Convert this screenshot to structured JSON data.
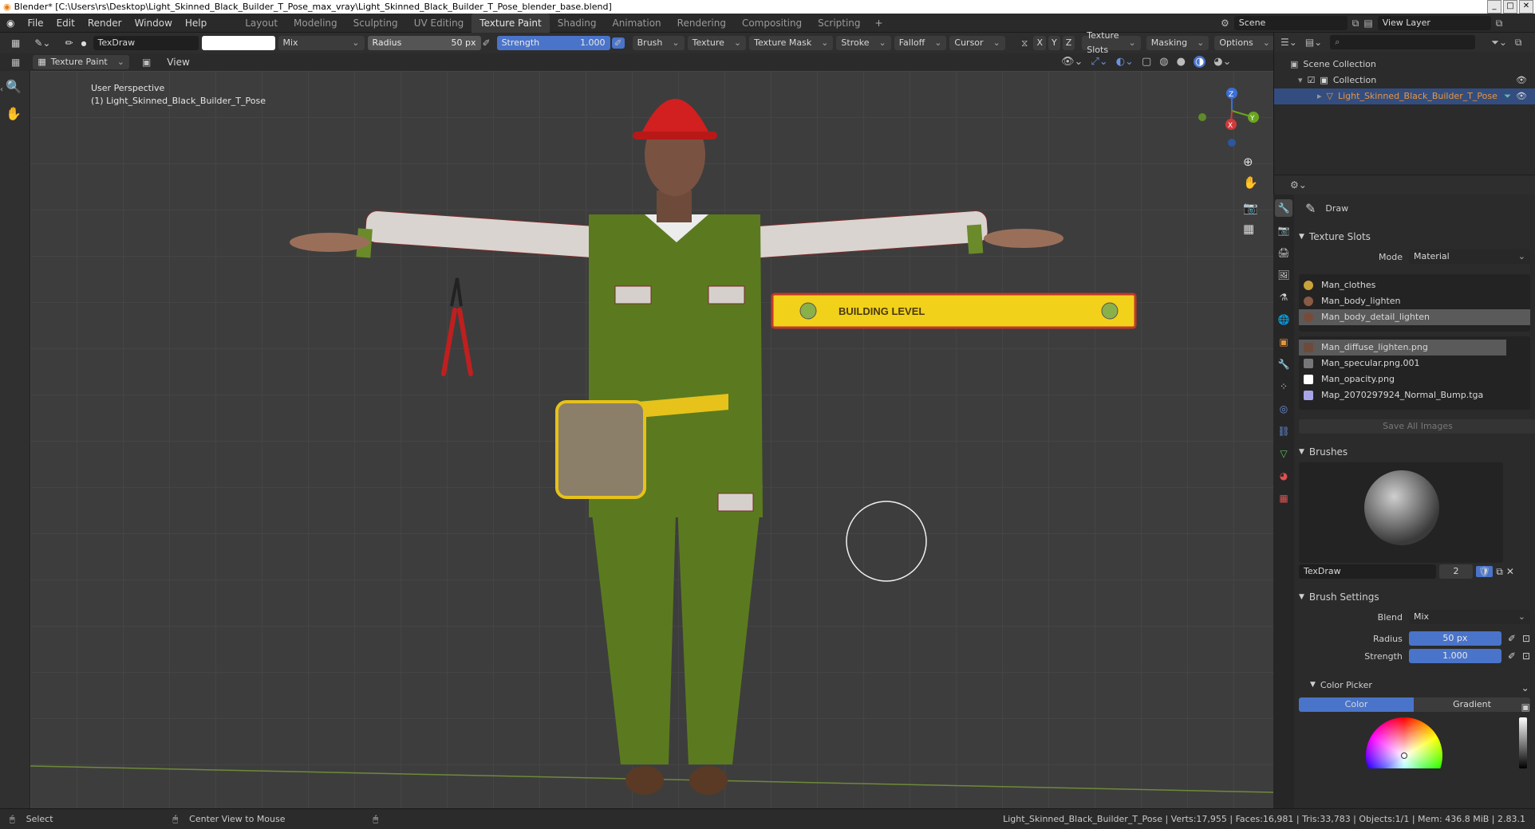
{
  "window": {
    "title": "Blender* [C:\\Users\\rs\\Desktop\\Light_Skinned_Black_Builder_T_Pose_max_vray\\Light_Skinned_Black_Builder_T_Pose_blender_base.blend]"
  },
  "menu": [
    "File",
    "Edit",
    "Render",
    "Window",
    "Help"
  ],
  "workspaces": [
    "Layout",
    "Modeling",
    "Sculpting",
    "UV Editing",
    "Texture Paint",
    "Shading",
    "Animation",
    "Rendering",
    "Compositing",
    "Scripting"
  ],
  "active_workspace": "Texture Paint",
  "scene": {
    "name": "Scene",
    "view_layer": "View Layer"
  },
  "tool_header": {
    "brush_name": "TexDraw",
    "blend": "Mix",
    "radius_label": "Radius",
    "radius_value": "50 px",
    "strength_label": "Strength",
    "strength_value": "1.000",
    "menus": [
      "Brush",
      "Texture",
      "Texture Mask",
      "Stroke",
      "Falloff",
      "Cursor"
    ],
    "axes": [
      "X",
      "Y",
      "Z"
    ],
    "right_menus": [
      "Texture Slots",
      "Masking",
      "Options"
    ]
  },
  "header2": {
    "mode": "Texture Paint",
    "view": "View"
  },
  "viewport": {
    "line1": "User Perspective",
    "line2": "(1) Light_Skinned_Black_Builder_T_Pose",
    "level_text": "BUILDING LEVEL",
    "gizmo": {
      "x": "X",
      "y": "Y",
      "z": "Z"
    }
  },
  "outliner": {
    "root": "Scene Collection",
    "collection": "Collection",
    "object": "Light_Skinned_Black_Builder_T_Pose"
  },
  "properties": {
    "tool_name": "Draw",
    "texture_slots_title": "Texture Slots",
    "mode_label": "Mode",
    "mode_value": "Material",
    "materials": [
      "Man_clothes",
      "Man_body_lighten",
      "Man_body_detail_lighten"
    ],
    "selected_material_index": 2,
    "images": [
      "Man_diffuse_lighten.png",
      "Man_specular.png.001",
      "Man_opacity.png",
      "Map_2070297924_Normal_Bump.tga"
    ],
    "selected_image_index": 0,
    "save_all": "Save All Images",
    "brushes_title": "Brushes",
    "brush_name": "TexDraw",
    "brush_users": "2",
    "brush_settings_title": "Brush Settings",
    "blend_label": "Blend",
    "blend_value": "Mix",
    "radius_label": "Radius",
    "radius_value": "50 px",
    "strength_label": "Strength",
    "strength_value": "1.000",
    "color_picker_title": "Color Picker",
    "color_tab": "Color",
    "gradient_tab": "Gradient"
  },
  "status": {
    "left1": "Select",
    "left2": "Center View to Mouse",
    "right": "Light_Skinned_Black_Builder_T_Pose | Verts:17,955 | Faces:16,981 | Tris:33,783 | Objects:1/1 | Mem: 436.8 MiB | 2.83.1"
  },
  "colors": {
    "accent": "#4a74c9",
    "viewport_bg": "#3d3d3d",
    "overalls": "#5b7a1f",
    "helmet": "#d21f1f",
    "level": "#f2d11a"
  }
}
